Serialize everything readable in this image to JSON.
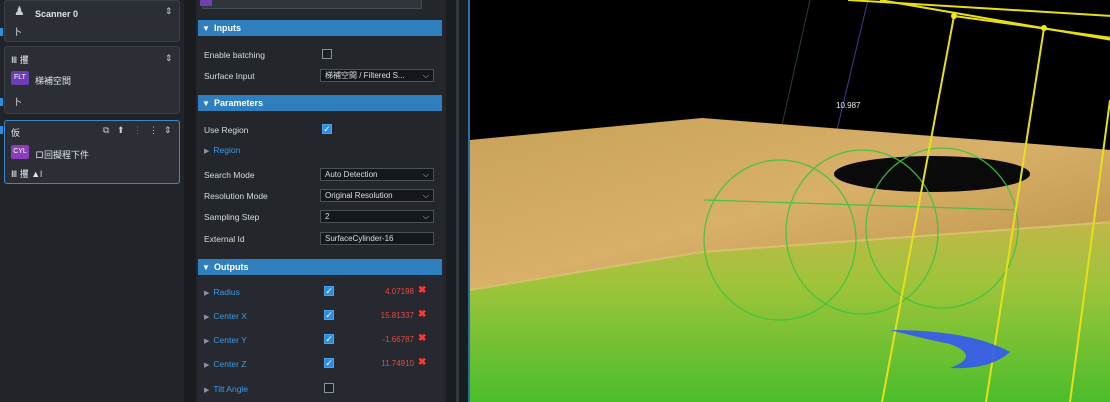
{
  "left_panel": {
    "scanner": {
      "title": "Scanner 0",
      "sub": "卜"
    },
    "filter": {
      "top": "Ⅲ 攫",
      "badge": "FLT",
      "title": "梯補空間",
      "sub": "卜"
    },
    "cylinder": {
      "top": "仮",
      "badge": "CYL",
      "title": "ロ回擬程下件",
      "sub": "Ⅲ 攫 ▲l"
    }
  },
  "inputs": {
    "header": "Inputs",
    "enable_batching_label": "Enable batching",
    "enable_batching": false,
    "surface_input_label": "Surface Input",
    "surface_input_value": "梯補空間 / Filtered S..."
  },
  "parameters": {
    "header": "Parameters",
    "use_region_label": "Use Region",
    "use_region": true,
    "region_label": "Region",
    "search_mode_label": "Search Mode",
    "search_mode_value": "Auto Detection",
    "resolution_mode_label": "Resolution Mode",
    "resolution_mode_value": "Original Resolution",
    "sampling_step_label": "Sampling Step",
    "sampling_step_value": "2",
    "external_id_label": "External Id",
    "external_id_value": "SurfaceCylinder-16"
  },
  "outputs": {
    "header": "Outputs",
    "items": [
      {
        "label": "Radius",
        "checked": true,
        "value": "4.07198"
      },
      {
        "label": "Center X",
        "checked": true,
        "value": "15.81337"
      },
      {
        "label": "Center Y",
        "checked": true,
        "value": "-1.66787"
      },
      {
        "label": "Center Z",
        "checked": true,
        "value": "11.74910"
      },
      {
        "label": "Tilt Angle",
        "checked": false,
        "value": ""
      }
    ]
  },
  "viewport": {
    "measurement": "10.987"
  },
  "colors": {
    "accent": "#2f7fbf",
    "error": "#e24848",
    "measure_line": "#e6df1a",
    "cylinder_fit": "#3fc43f"
  }
}
